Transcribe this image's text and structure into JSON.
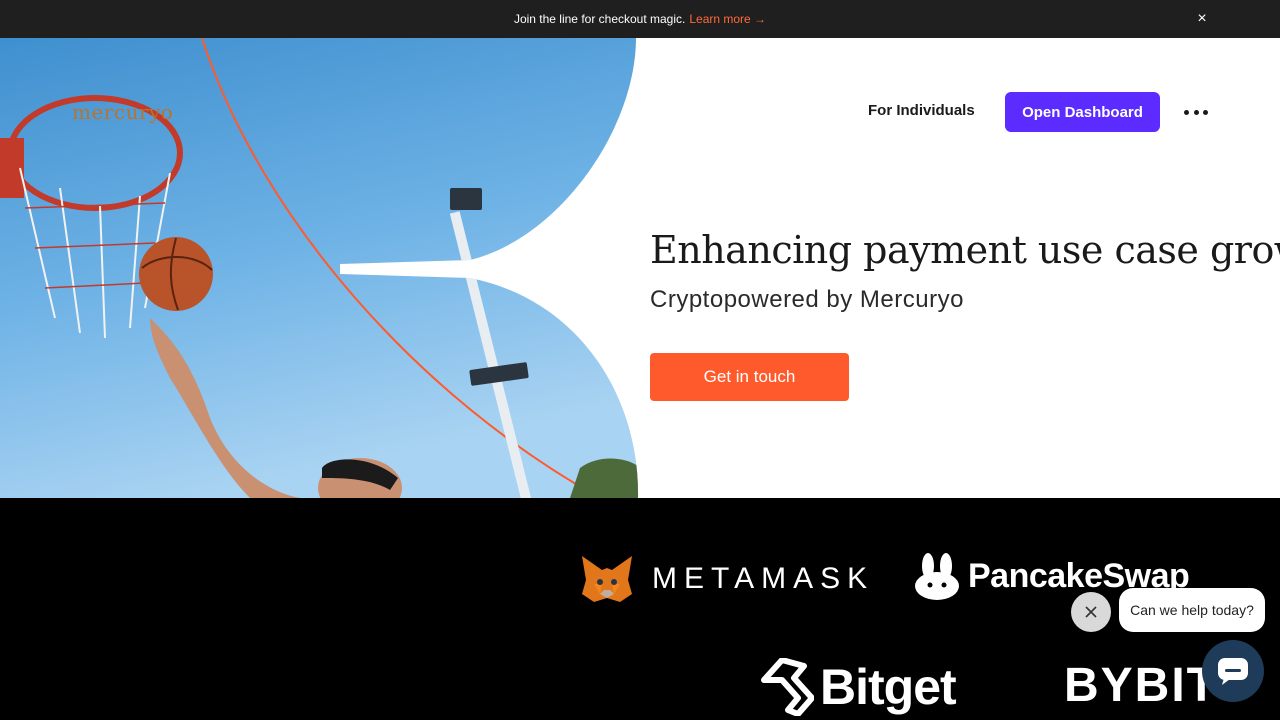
{
  "banner": {
    "message": "Join the line for checkout magic.",
    "link_label": "Learn more →",
    "close_label": "×"
  },
  "brand": {
    "logo_text": "mercuryo"
  },
  "nav": {
    "individuals_label": "For Individuals",
    "dashboard_label": "Open Dashboard",
    "more_icon": "more-dots-icon"
  },
  "hero": {
    "headline": "Enhancing payment use case growth",
    "subline": "Cryptopowered by Mercuryo",
    "cta_label": "Get in touch"
  },
  "partners": [
    {
      "name": "METAMASK",
      "icon": "metamask-fox-icon"
    },
    {
      "name": "PancakeSwap",
      "icon": "pancakeswap-bunny-icon"
    },
    {
      "name": "Bitget",
      "icon": "bitget-arrows-icon"
    },
    {
      "name": "BYBIT",
      "icon": ""
    }
  ],
  "chat": {
    "prompt": "Can we help today?",
    "close_icon": "close-icon",
    "launcher_icon": "chat-icon"
  },
  "colors": {
    "accent_purple": "#5b2bff",
    "accent_orange": "#ff5a2c",
    "banner_bg": "#1f1f1f",
    "logo_color": "#b8732f",
    "partners_bg": "#000000",
    "chat_launcher": "#1f3b5a"
  }
}
